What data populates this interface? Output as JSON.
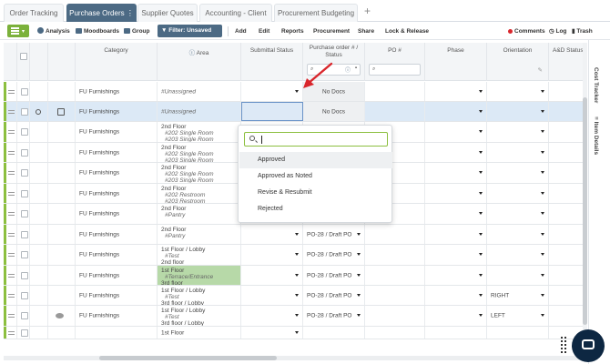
{
  "tabs": [
    {
      "label": "Order Tracking"
    },
    {
      "label": "Purchase Orders"
    },
    {
      "label": "Supplier Quotes"
    },
    {
      "label": "Accounting - Client"
    },
    {
      "label": "Procurement Budgeting"
    }
  ],
  "tab_menu_glyph": "⋮",
  "toolbar": {
    "analysis": "Analysis",
    "moodboards": "Moodboards",
    "group": "Group",
    "filter": "Filter: Unsaved filter",
    "add": "Add",
    "edit": "Edit",
    "reports": "Reports",
    "procurement": "Procurement",
    "share": "Share",
    "lock_release": "Lock & Release",
    "comments": "Comments",
    "log": "Log",
    "trash": "Trash"
  },
  "columns": {
    "category": "Category",
    "area": "Area",
    "submittal_status": "Submittal Status",
    "po_status": "Purchase order # / Status",
    "po_num": "PO #",
    "phase": "Phase",
    "orientation": "Orientation",
    "ad_status": "A&D Status"
  },
  "rows": [
    {
      "category": "FU Furnishings",
      "area": [
        "#Unassigned"
      ],
      "po": "No Docs",
      "orientation": ""
    },
    {
      "category": "FU Furnishings",
      "area": [
        "#Unassigned"
      ],
      "po": "No Docs",
      "orientation": ""
    },
    {
      "category": "FU Furnishings",
      "area": [
        "2nd Floor",
        "#202 Single Room",
        "#203 Single Room"
      ],
      "po": "",
      "orientation": ""
    },
    {
      "category": "FU Furnishings",
      "area": [
        "2nd Floor",
        "#202 Single Room",
        "#203 Single Room"
      ],
      "po": "",
      "orientation": ""
    },
    {
      "category": "FU Furnishings",
      "area": [
        "2nd Floor",
        "#202 Single Room",
        "#203 Single Room"
      ],
      "po": "",
      "orientation": ""
    },
    {
      "category": "FU Furnishings",
      "area": [
        "2nd Floor",
        "#202 Restroom",
        "#203 Restroom"
      ],
      "po": "",
      "orientation": ""
    },
    {
      "category": "FU Furnishings",
      "area": [
        "2nd Floor",
        "#Pantry"
      ],
      "po": "PO-28 / Draft PO",
      "orientation": ""
    },
    {
      "category": "FU Furnishings",
      "area": [
        "2nd Floor",
        "#Pantry"
      ],
      "po": "PO-28 / Draft PO",
      "orientation": ""
    },
    {
      "category": "FU Furnishings",
      "area": [
        "1st Floor / Lobby",
        "#Test",
        "2nd floor"
      ],
      "po": "PO-28 / Draft PO",
      "orientation": ""
    },
    {
      "category": "FU Furnishings",
      "area": [
        "1st Floor",
        "#Terrace/Entrance",
        "3rd floor"
      ],
      "po": "PO-28 / Draft PO",
      "orientation": ""
    },
    {
      "category": "FU Furnishings",
      "area": [
        "1st Floor / Lobby",
        "#Test",
        "3rd floor / Lobby"
      ],
      "po": "PO-28 / Draft PO",
      "orientation": "RIGHT"
    },
    {
      "category": "FU Furnishings",
      "area": [
        "1st Floor / Lobby",
        "#Test",
        "3rd floor / Lobby"
      ],
      "po": "PO-28 / Draft PO",
      "orientation": "LEFT"
    },
    {
      "category": "",
      "area": [
        "1st Floor"
      ],
      "po": "",
      "orientation": ""
    }
  ],
  "dropdown": {
    "options": [
      "Approved",
      "Approved as Noted",
      "Revise & Resubmit",
      "Rejected"
    ]
  },
  "side_panel": {
    "cost_tracker": "Cost Tracker",
    "item_details": "Item Details"
  },
  "colors": {
    "accent": "#4c6a84",
    "green": "#8cbf3f",
    "arrow": "#d9262c",
    "chat": "#0d2742"
  }
}
